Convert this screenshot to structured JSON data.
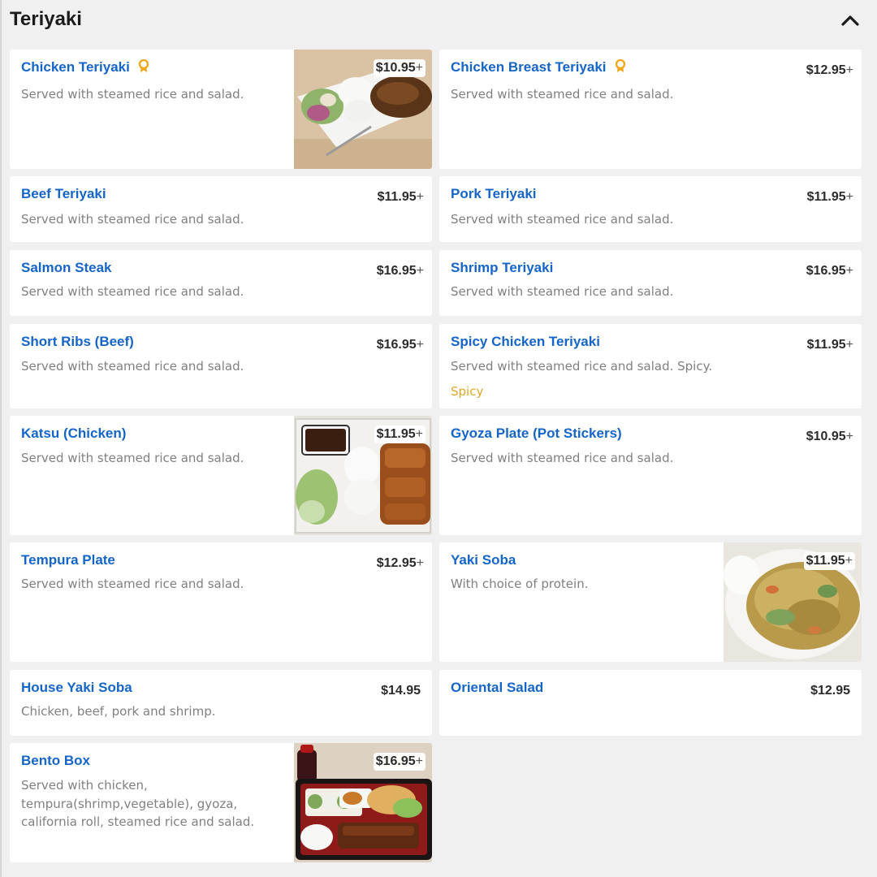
{
  "section": {
    "title": "Teriyaki"
  },
  "items": [
    {
      "name": "Chicken Teriyaki",
      "price": "$10.95",
      "plus": "+",
      "desc": "Served with steamed rice and salad.",
      "badge": "award-icon"
    },
    {
      "name": "Chicken Breast Teriyaki",
      "price": "$12.95",
      "plus": "+",
      "desc": "Served with steamed rice and salad.",
      "badge": "award-icon"
    },
    {
      "name": "Beef Teriyaki",
      "price": "$11.95",
      "plus": "+",
      "desc": "Served with steamed rice and salad."
    },
    {
      "name": "Pork Teriyaki",
      "price": "$11.95",
      "plus": "+",
      "desc": "Served with steamed rice and salad."
    },
    {
      "name": "Salmon Steak",
      "price": "$16.95",
      "plus": "+",
      "desc": "Served with steamed rice and salad."
    },
    {
      "name": "Shrimp Teriyaki",
      "price": "$16.95",
      "plus": "+",
      "desc": "Served with steamed rice and salad."
    },
    {
      "name": "Short Ribs (Beef)",
      "price": "$16.95",
      "plus": "+",
      "desc": "Served with steamed rice and salad."
    },
    {
      "name": "Spicy Chicken Teriyaki",
      "price": "$11.95",
      "plus": "+",
      "desc": "Served with steamed rice and salad. Spicy.",
      "tag": "Spicy"
    },
    {
      "name": "Katsu (Chicken)",
      "price": "$11.95",
      "plus": "+",
      "desc": "Served with steamed rice and salad."
    },
    {
      "name": "Gyoza Plate (Pot Stickers)",
      "price": "$10.95",
      "plus": "+",
      "desc": "Served with steamed rice and salad."
    },
    {
      "name": "Tempura Plate",
      "price": "$12.95",
      "plus": "+",
      "desc": "Served with steamed rice and salad."
    },
    {
      "name": "Yaki Soba",
      "price": "$11.95",
      "plus": "+",
      "desc": "With choice of protein."
    },
    {
      "name": "House Yaki Soba",
      "price": "$14.95",
      "plus": "",
      "desc": "Chicken, beef, pork and shrimp."
    },
    {
      "name": "Oriental Salad",
      "price": "$12.95",
      "plus": "",
      "desc": ""
    },
    {
      "name": "Bento Box",
      "price": "$16.95",
      "plus": "+",
      "desc": "Served with chicken, tempura(shrimp,vegetable), gyoza, california roll, steamed rice and salad."
    }
  ],
  "colors": {
    "item_name": "#1565c8",
    "badge": "#f0a820",
    "spicy_tag": "#e0a82a",
    "background": "#f0f0f0",
    "card": "#ffffff"
  },
  "icons": {
    "collapse": "chevron-up-icon",
    "badge": "award-icon"
  }
}
